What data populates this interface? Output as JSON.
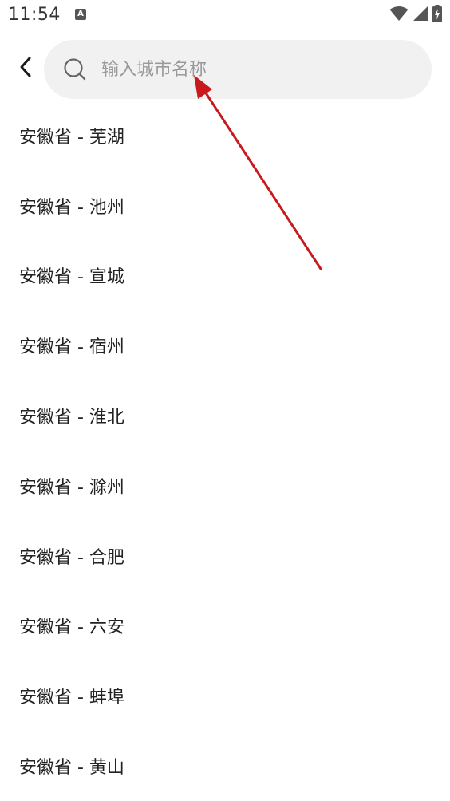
{
  "status_bar": {
    "time": "11:54",
    "notification_icon_letter": "A",
    "wifi_icon": "wifi-icon",
    "signal_icon": "signal-icon",
    "battery_icon": "battery-charging-icon"
  },
  "header": {
    "back_icon": "chevron-left-icon",
    "search": {
      "placeholder": "输入城市名称",
      "value": "",
      "icon": "search-icon"
    }
  },
  "city_list": [
    {
      "label": "安徽省 - 芜湖"
    },
    {
      "label": "安徽省 - 池州"
    },
    {
      "label": "安徽省 - 宣城"
    },
    {
      "label": "安徽省 - 宿州"
    },
    {
      "label": "安徽省 - 淮北"
    },
    {
      "label": "安徽省 - 滁州"
    },
    {
      "label": "安徽省 - 合肥"
    },
    {
      "label": "安徽省 - 六安"
    },
    {
      "label": "安徽省 - 蚌埠"
    },
    {
      "label": "安徽省 - 黄山"
    }
  ],
  "annotation": {
    "arrow_color": "#c8191c"
  },
  "colors": {
    "background": "#ffffff",
    "search_background": "#f1f1f1",
    "placeholder": "#9a9a9a",
    "text": "#222222"
  }
}
